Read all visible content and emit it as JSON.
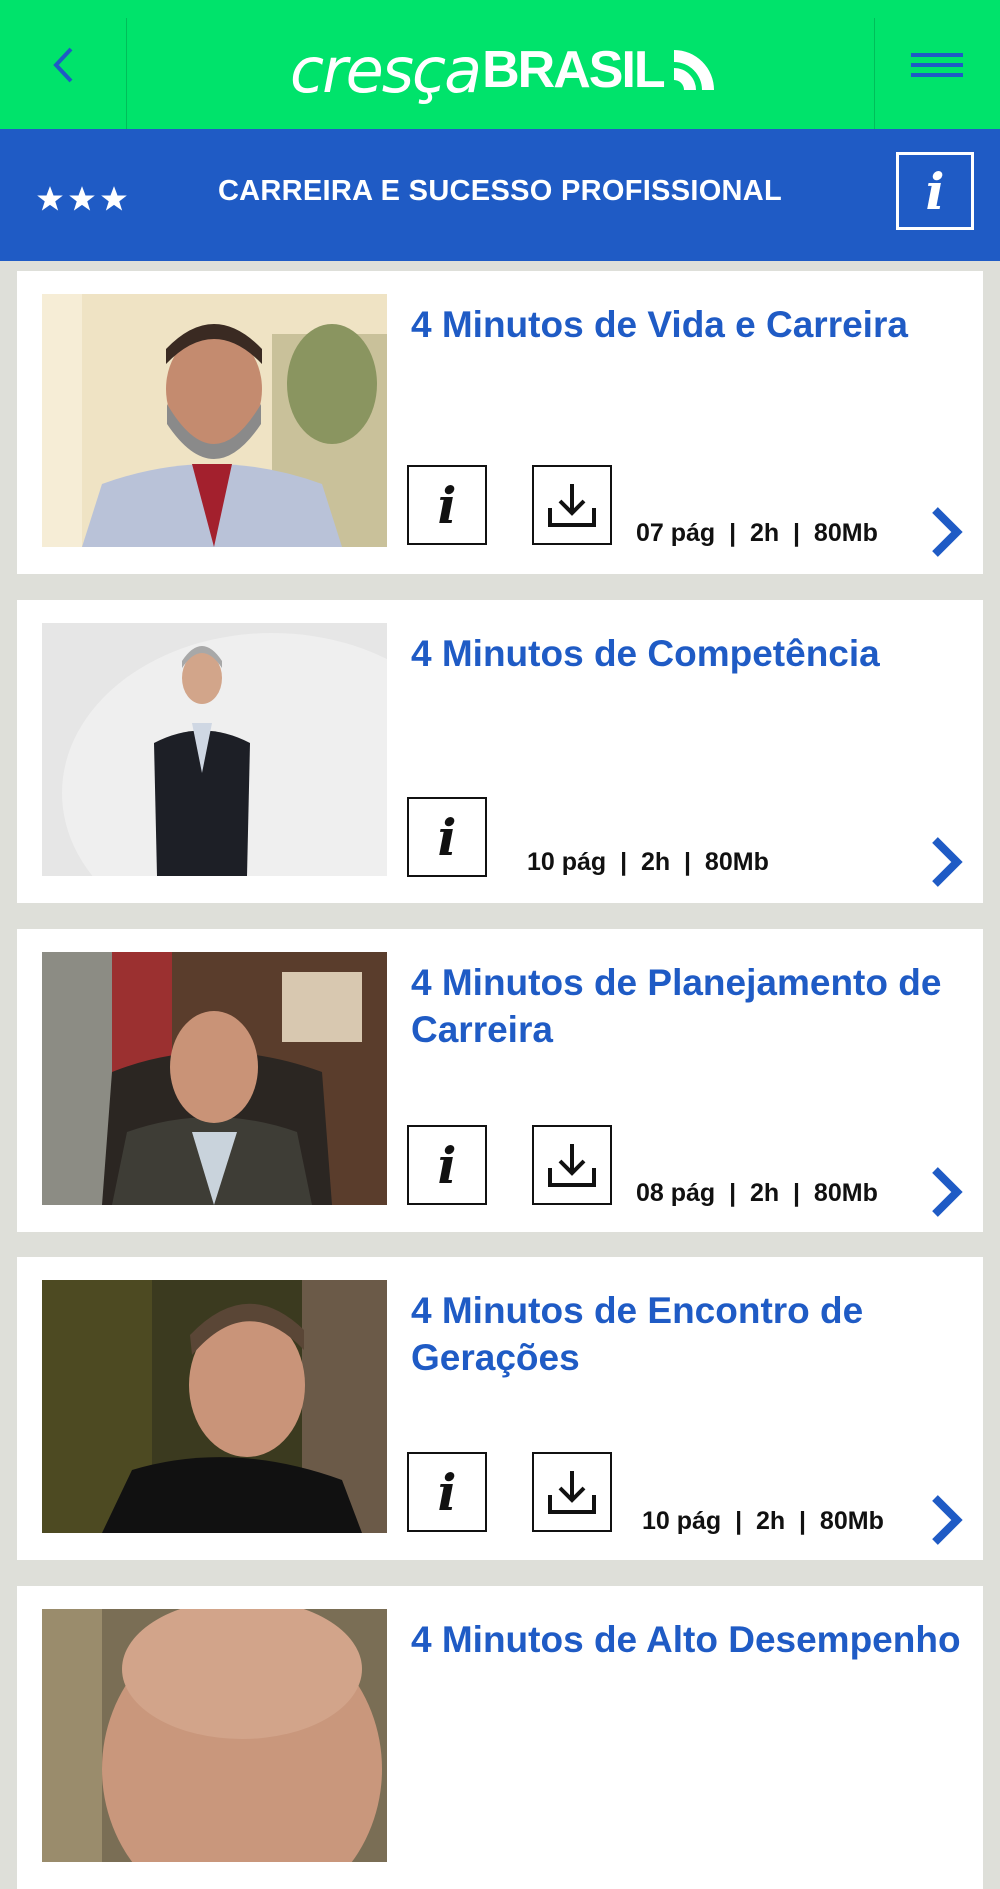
{
  "header": {
    "logo_part1": "cresça",
    "logo_part2": "BRASIL",
    "brand_color": "#00e36b"
  },
  "category": {
    "title": "CARREIRA E SUCESSO PROFISSIONAL",
    "stars": 3,
    "info_label": "i",
    "bar_color": "#1f5bc5"
  },
  "courses": [
    {
      "title": "4 Minutos de Vida e Carreira",
      "meta": "07 pág  |  2h  |  80Mb",
      "info_label": "i",
      "has_download": true
    },
    {
      "title": "4 Minutos de Competência",
      "meta": "10 pág  |  2h  |  80Mb",
      "info_label": "i",
      "has_download": false
    },
    {
      "title": "4 Minutos de Planejamento de Carreira",
      "meta": "08 pág  |  2h  |  80Mb",
      "info_label": "i",
      "has_download": true
    },
    {
      "title": "4 Minutos de Encontro de Gerações",
      "meta": "10 pág  |  2h  |  80Mb",
      "info_label": "i",
      "has_download": true
    },
    {
      "title": "4 Minutos de Alto Desempenho"
    }
  ]
}
